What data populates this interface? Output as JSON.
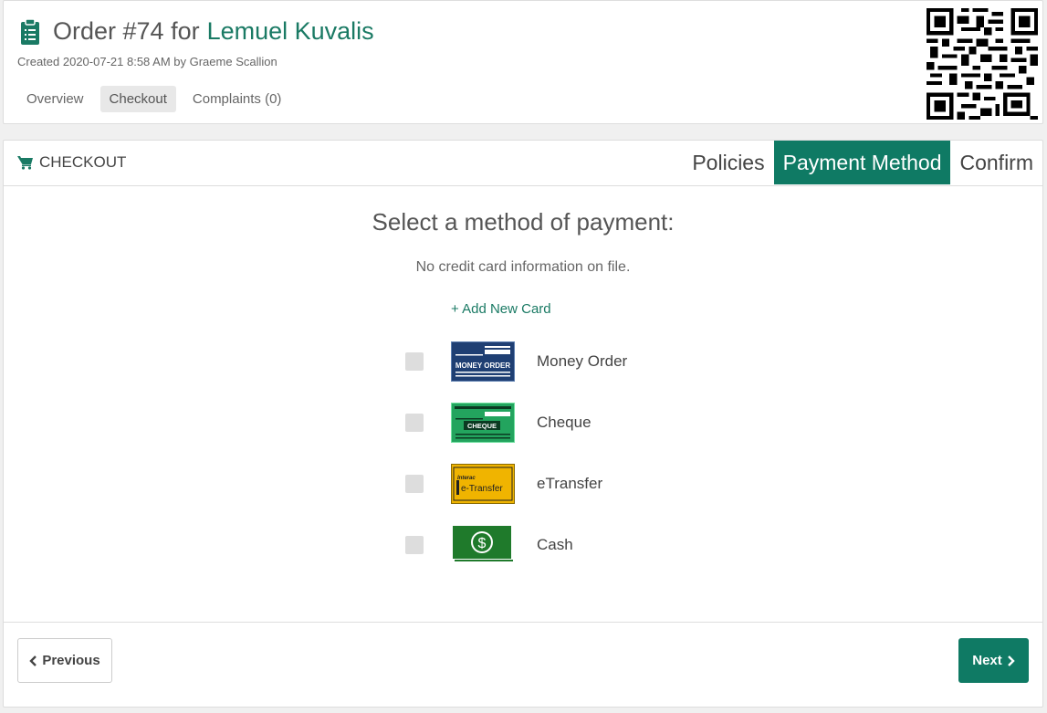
{
  "order": {
    "title_prefix": "Order #74 for",
    "customer": "Lemuel Kuvalis",
    "created": "Created 2020-07-21 8:58 AM by Graeme Scallion"
  },
  "tabs": [
    {
      "label": "Overview",
      "active": false
    },
    {
      "label": "Checkout",
      "active": true
    },
    {
      "label": "Complaints (0)",
      "active": false
    }
  ],
  "checkout": {
    "title": "CHECKOUT",
    "steps": [
      {
        "label": "Policies",
        "active": false
      },
      {
        "label": "Payment Method",
        "active": true
      },
      {
        "label": "Confirm",
        "active": false
      }
    ],
    "heading": "Select a method of payment:",
    "no_card": "No credit card information on file.",
    "add_card": "+ Add New Card",
    "methods": [
      {
        "label": "Money Order",
        "icon": "money-order-icon",
        "image_text": "MONEY ORDER",
        "checked": false
      },
      {
        "label": "Cheque",
        "icon": "cheque-icon",
        "image_text": "CHEQUE",
        "checked": false
      },
      {
        "label": "eTransfer",
        "icon": "etransfer-icon",
        "image_text": "e-Transfer",
        "image_subtext": "Interac",
        "checked": false
      },
      {
        "label": "Cash",
        "icon": "cash-icon",
        "image_text": "$",
        "checked": false
      }
    ],
    "prev_label": "Previous",
    "next_label": "Next"
  },
  "colors": {
    "accent": "#0f7a64",
    "link": "#1a7a64"
  }
}
